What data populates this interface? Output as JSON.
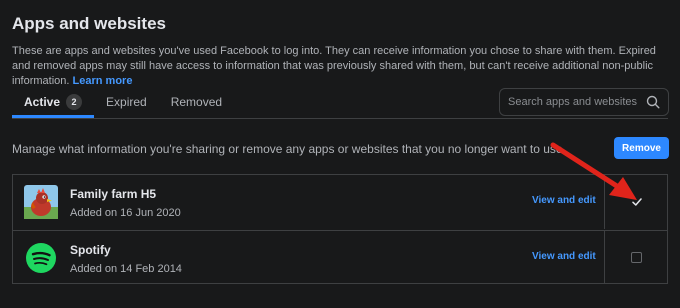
{
  "page": {
    "title": "Apps and websites",
    "description": "These are apps and websites you've used Facebook to log into. They can receive information you chose to share with them. Expired and removed apps may still have access to information that was previously shared with them, but can't receive additional non-public information.",
    "learn_more": "Learn more"
  },
  "tabs": [
    {
      "label": "Active",
      "badge": "2",
      "active": true
    },
    {
      "label": "Expired",
      "active": false
    },
    {
      "label": "Removed",
      "active": false
    }
  ],
  "search": {
    "placeholder": "Search apps and websites",
    "value": ""
  },
  "manage_text": "Manage what information you're sharing or remove any apps or websites that you no longer want to use.",
  "remove_label": "Remove",
  "apps": [
    {
      "name": "Family farm H5",
      "added": "Added on 16 Jun 2020",
      "action": "View and edit",
      "checked": true,
      "icon": "family-farm-logo"
    },
    {
      "name": "Spotify",
      "added": "Added on 14 Feb 2014",
      "action": "View and edit",
      "checked": false,
      "icon": "spotify-logo"
    }
  ],
  "colors": {
    "background": "#18191a",
    "accent": "#2d88ff",
    "link": "#4599ff",
    "border": "#3e4042",
    "annotation_arrow": "#e0241b",
    "spotify_green": "#1ed760"
  }
}
